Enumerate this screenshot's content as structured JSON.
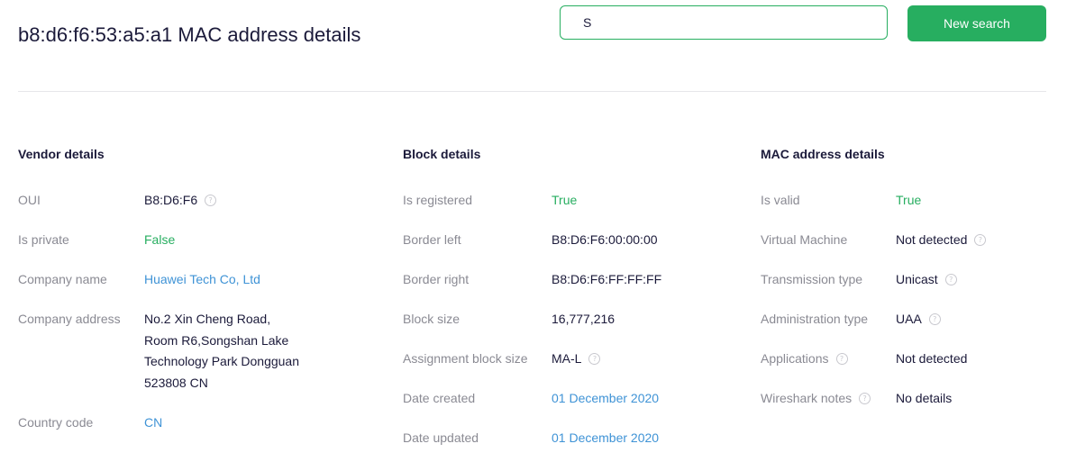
{
  "header": {
    "title": "b8:d6:f6:53:a5:a1 MAC address details",
    "search_value": "S",
    "search_button_label": "New search"
  },
  "colors": {
    "accent": "#27ae60",
    "link": "#3f93d6",
    "label": "#8a8a93",
    "text": "#1b1a3a"
  },
  "vendor": {
    "heading": "Vendor details",
    "oui_label": "OUI",
    "oui_value": "B8:D6:F6",
    "private_label": "Is private",
    "private_value": "False",
    "company_label": "Company name",
    "company_value": "Huawei Tech Co, Ltd",
    "address_label": "Company address",
    "address_lines": [
      "No.2 Xin Cheng Road,",
      "Room R6,Songshan Lake",
      "Technology Park Dongguan",
      "523808 CN"
    ],
    "country_label": "Country code",
    "country_value": "CN"
  },
  "block": {
    "heading": "Block details",
    "registered_label": "Is registered",
    "registered_value": "True",
    "border_left_label": "Border left",
    "border_left_value": "B8:D6:F6:00:00:00",
    "border_right_label": "Border right",
    "border_right_value": "B8:D6:F6:FF:FF:FF",
    "size_label": "Block size",
    "size_value": "16,777,216",
    "assignment_label": "Assignment block size",
    "assignment_value": "MA-L",
    "created_label": "Date created",
    "created_value": "01 December 2020",
    "updated_label": "Date updated",
    "updated_value": "01 December 2020"
  },
  "mac": {
    "heading": "MAC address details",
    "valid_label": "Is valid",
    "valid_value": "True",
    "vm_label": "Virtual Machine",
    "vm_value": "Not detected",
    "transmission_label": "Transmission type",
    "transmission_value": "Unicast",
    "admin_label": "Administration type",
    "admin_value": "UAA",
    "applications_label": "Applications",
    "applications_value": "Not detected",
    "wireshark_label": "Wireshark notes",
    "wireshark_value": "No details"
  }
}
